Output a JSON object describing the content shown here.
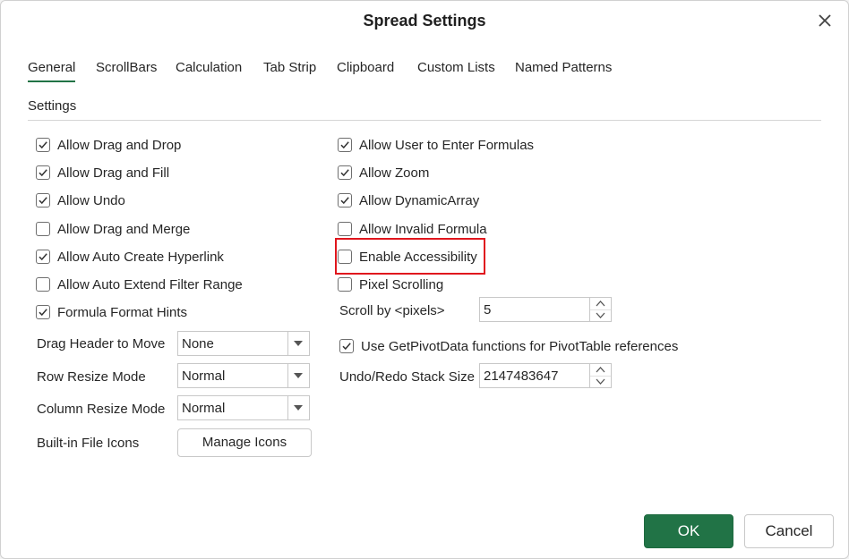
{
  "dialog": {
    "title": "Spread Settings"
  },
  "tabs": [
    "General",
    "ScrollBars",
    "Calculation",
    "Tab Strip",
    "Clipboard",
    "Custom Lists",
    "Named Patterns"
  ],
  "active_tab": "General",
  "section": {
    "label": "Settings"
  },
  "left_checkboxes": [
    {
      "label": "Allow Drag and Drop",
      "checked": true
    },
    {
      "label": "Allow Drag and Fill",
      "checked": true
    },
    {
      "label": "Allow Undo",
      "checked": true
    },
    {
      "label": "Allow Drag and Merge",
      "checked": false
    },
    {
      "label": "Allow Auto Create Hyperlink",
      "checked": true
    },
    {
      "label": "Allow Auto Extend Filter Range",
      "checked": false
    },
    {
      "label": "Formula Format Hints",
      "checked": true
    }
  ],
  "right_checkboxes": [
    {
      "label": "Allow User to Enter Formulas",
      "checked": true
    },
    {
      "label": "Allow Zoom",
      "checked": true
    },
    {
      "label": "Allow DynamicArray",
      "checked": true
    },
    {
      "label": "Allow Invalid Formula",
      "checked": false
    },
    {
      "label": "Enable Accessibility",
      "checked": false
    },
    {
      "label": "Pixel Scrolling",
      "checked": false
    }
  ],
  "scroll_by": {
    "label": "Scroll by <pixels>",
    "value": "5"
  },
  "pivot": {
    "label": "Use GetPivotData functions for PivotTable references",
    "checked": true
  },
  "undo_stack": {
    "label": "Undo/Redo Stack Size",
    "value": "2147483647"
  },
  "dropdowns": {
    "drag_header": {
      "label": "Drag Header to Move",
      "value": "None"
    },
    "row_resize": {
      "label": "Row Resize Mode",
      "value": "Normal"
    },
    "column_resize": {
      "label": "Column Resize Mode",
      "value": "Normal"
    }
  },
  "file_icons": {
    "label": "Built-in File Icons",
    "button": "Manage Icons"
  },
  "footer": {
    "ok": "OK",
    "cancel": "Cancel"
  },
  "colors": {
    "accent": "#217346",
    "highlight": "#e0161d"
  }
}
